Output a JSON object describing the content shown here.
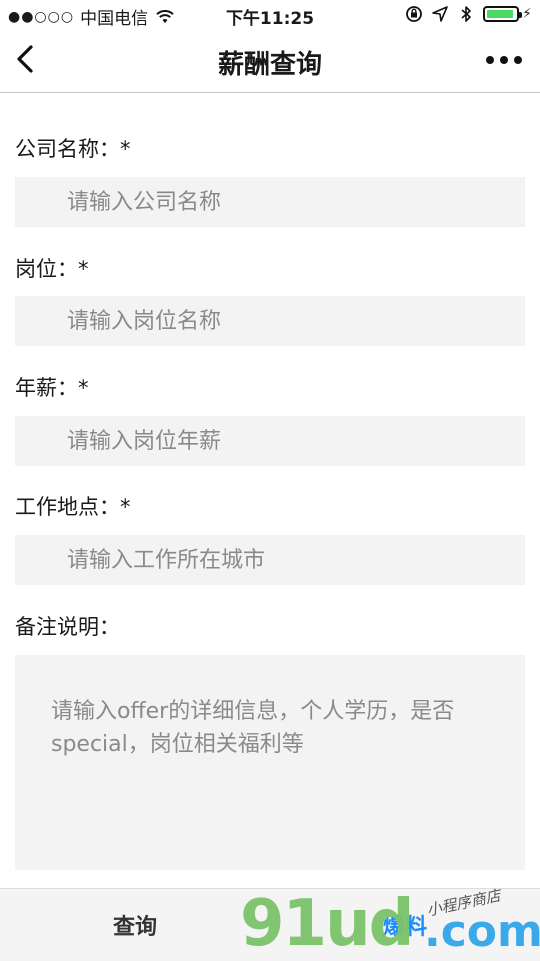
{
  "status_bar": {
    "signal": "●●○○○",
    "carrier": "中国电信",
    "time": "下午11:25"
  },
  "nav": {
    "title": "薪酬查询"
  },
  "form": {
    "company": {
      "label": "公司名称：*",
      "placeholder": "请输入公司名称",
      "value": ""
    },
    "position": {
      "label": "岗位：*",
      "placeholder": "请输入岗位名称",
      "value": ""
    },
    "salary": {
      "label": "年薪：*",
      "placeholder": "请输入岗位年薪",
      "value": ""
    },
    "location": {
      "label": "工作地点：*",
      "placeholder": "请输入工作所在城市",
      "value": ""
    },
    "notes": {
      "label": "备注说明：",
      "placeholder": "请输入offer的详细信息，个人学历，是否special，岗位相关福利等",
      "value": ""
    }
  },
  "bottom_bar": {
    "query_label": "查询",
    "submit_label": "爆料"
  },
  "watermark": {
    "logo": "91ud",
    "domain": ".com",
    "tagline": "小程序商店"
  },
  "colors": {
    "accent": "#1a8cff",
    "field_bg": "#f3f3f3",
    "battery": "#4cd964"
  }
}
